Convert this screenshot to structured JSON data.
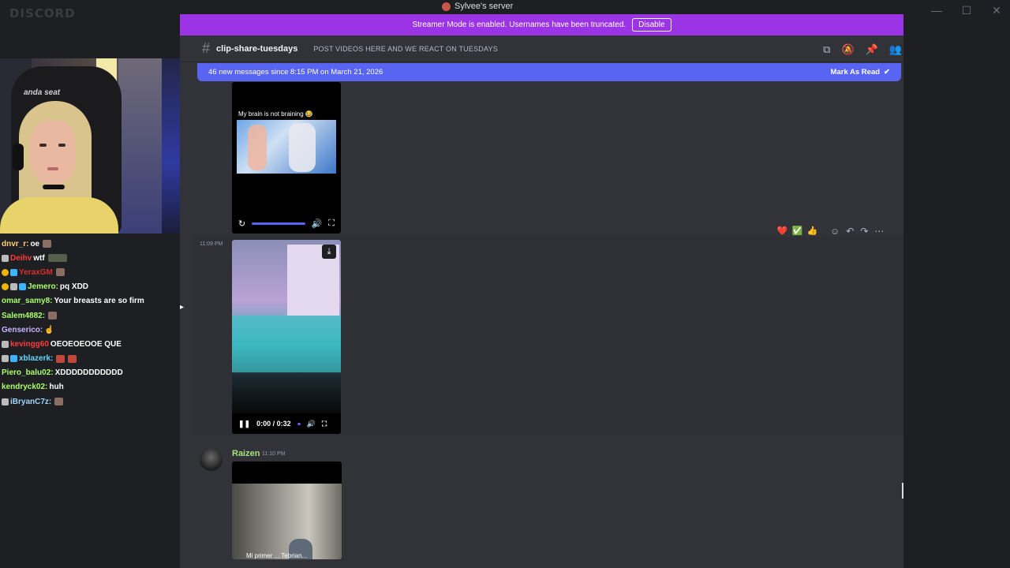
{
  "brand": "DISCORD",
  "window": {
    "title": "Sylvee's server",
    "controls": [
      "—",
      "☐",
      "✕"
    ]
  },
  "streamer_bar": {
    "text": "Streamer Mode is enabled. Usernames have been truncated.",
    "button": "Disable"
  },
  "channel": {
    "name": "clip-share-tuesdays",
    "topic": "POST VIDEOS HERE AND WE REACT ON TUESDAYS"
  },
  "new_messages": {
    "text": "46 new messages since 8:15 PM on March 21, 2026",
    "action": "Mark As Read"
  },
  "video1": {
    "caption": "My brain is not braining 😂"
  },
  "reactions": [
    "❤️",
    "✅",
    "👍"
  ],
  "message2": {
    "time": "11:09 PM",
    "video_time": "0:00 / 0:32"
  },
  "message3": {
    "author": "Raizen",
    "time": "11:10 PM",
    "subtitle": "Mi primer ... Tebrian..."
  },
  "chat": [
    {
      "user": "dnvr_r:",
      "msg": "oe",
      "color": "#ffd27a"
    },
    {
      "user": "Deihv",
      "msg": "wtf",
      "color": "#ff3b3b"
    },
    {
      "user": "YeraxGM",
      "msg": "",
      "color": "#d72f2f"
    },
    {
      "user": "Jemero:",
      "msg": "pq XDD",
      "color": "#a9ff6b"
    },
    {
      "user": "omar_samy8:",
      "msg": "Your breasts are so firm",
      "color": "#a9ff6b"
    },
    {
      "user": "Salem4882:",
      "msg": "",
      "color": "#a9ff6b"
    },
    {
      "user": "Genserico:",
      "msg": "☝",
      "color": "#cbb4ff"
    },
    {
      "user": "kevingg60",
      "msg": "OEOEOEOOE QUE",
      "color": "#ff3b3b"
    },
    {
      "user": "xblazerk:",
      "msg": "",
      "color": "#64d7ff"
    },
    {
      "user": "Piero_balu02:",
      "msg": "XDDDDDDDDDDD",
      "color": "#a9ff6b"
    },
    {
      "user": "kendryck02:",
      "msg": "huh",
      "color": "#a9ff6b"
    },
    {
      "user": "iBryanC7z:",
      "msg": "",
      "color": "#9fd4ff"
    }
  ]
}
